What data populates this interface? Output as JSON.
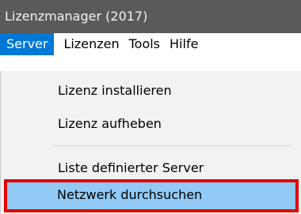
{
  "window": {
    "title": "Lizenzmanager (2017)"
  },
  "menubar": {
    "items": [
      {
        "label": "Server"
      },
      {
        "label": "Lizenzen"
      },
      {
        "label": "Tools"
      },
      {
        "label": "Hilfe"
      }
    ]
  },
  "dropdown": {
    "items": [
      {
        "label": "Lizenz installieren"
      },
      {
        "label": "Lizenz aufheben"
      },
      {
        "label": "Liste definierter Server"
      },
      {
        "label": "Netzwerk durchsuchen"
      }
    ]
  },
  "colors": {
    "titlebar": "#5a5a5a",
    "menu_active": "#0078d7",
    "item_highlight": "#91c9f7",
    "annotation_border": "#e00000"
  }
}
